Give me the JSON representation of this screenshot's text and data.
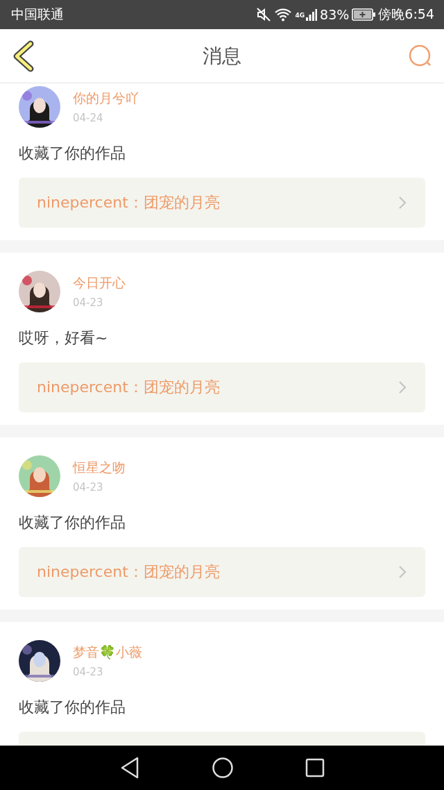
{
  "status_bar": {
    "carrier": "中国联通",
    "network": "4G",
    "battery": "83%",
    "time": "傍晚6:54"
  },
  "header": {
    "title": "消息"
  },
  "messages": [
    {
      "name": "你的月兮吖",
      "date": "04-24",
      "text": "收藏了你的作品",
      "link": {
        "text": "ninepercent：团宠的月亮"
      }
    },
    {
      "name": "今日开心",
      "date": "04-23",
      "text": "哎呀，好看~",
      "link": {
        "text": "ninepercent：团宠的月亮"
      }
    },
    {
      "name": "恒星之吻",
      "date": "04-23",
      "text": "收藏了你的作品",
      "link": {
        "text": "ninepercent：团宠的月亮"
      }
    },
    {
      "name": "梦音🍀小薇",
      "date": "04-23",
      "text": "收藏了你的作品",
      "link_cut_off": true
    }
  ]
}
